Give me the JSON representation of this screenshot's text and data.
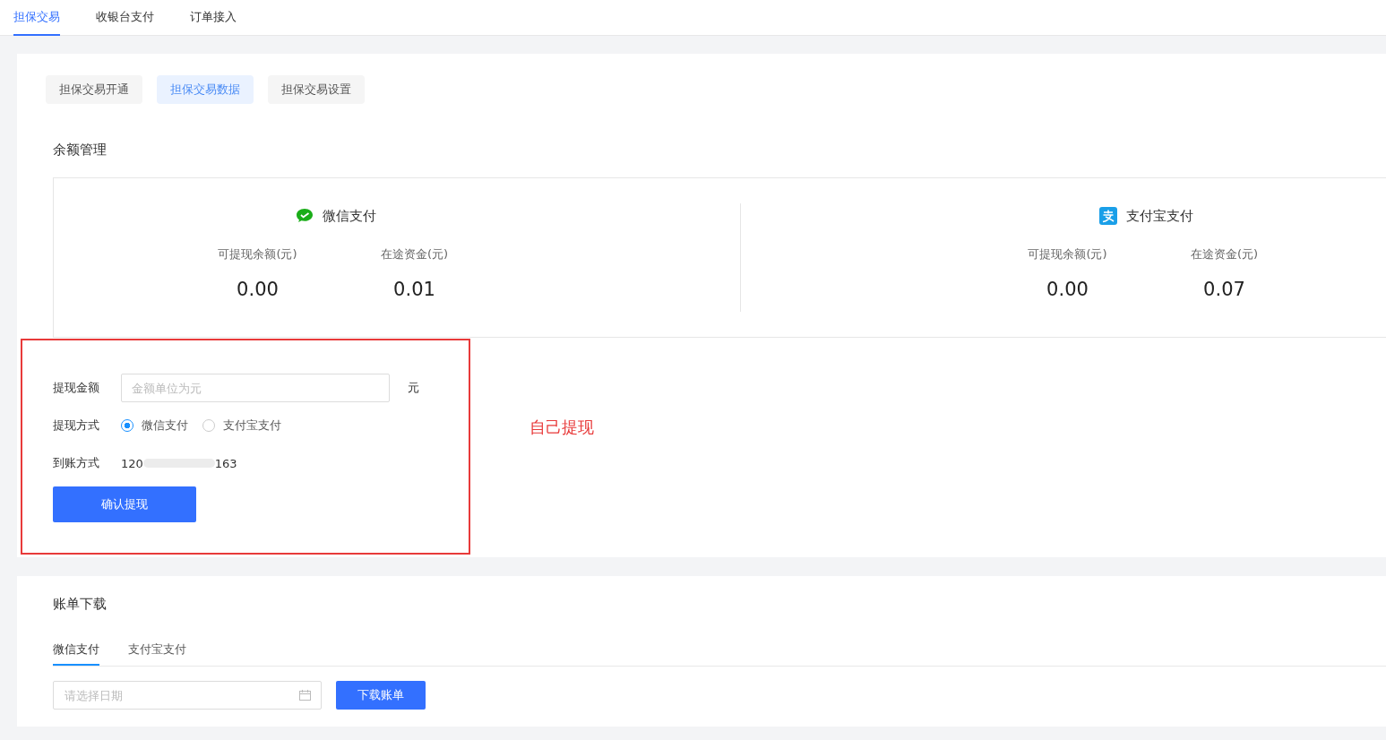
{
  "top_tabs": [
    {
      "label": "担保交易",
      "selected": true
    },
    {
      "label": "收银台支付",
      "selected": false
    },
    {
      "label": "订单接入",
      "selected": false
    }
  ],
  "sub_tabs": [
    {
      "label": "担保交易开通",
      "selected": false
    },
    {
      "label": "担保交易数据",
      "selected": true
    },
    {
      "label": "担保交易设置",
      "selected": false
    }
  ],
  "balance": {
    "title": "余额管理",
    "accounts": [
      {
        "kind": "wechat",
        "name": "微信支付",
        "stats": [
          {
            "label": "可提现余额(元)",
            "value": "0.00"
          },
          {
            "label": "在途资金(元)",
            "value": "0.01"
          }
        ]
      },
      {
        "kind": "alipay",
        "name": "支付宝支付",
        "stats": [
          {
            "label": "可提现余额(元)",
            "value": "0.00"
          },
          {
            "label": "在途资金(元)",
            "value": "0.07"
          }
        ]
      }
    ]
  },
  "withdraw": {
    "amount_label": "提现金额",
    "amount_placeholder": "金额单位为元",
    "unit": "元",
    "method_label": "提现方式",
    "methods": [
      {
        "label": "微信支付",
        "selected": true
      },
      {
        "label": "支付宝支付",
        "selected": false
      }
    ],
    "account_label": "到账方式",
    "account_prefix": "120",
    "account_suffix": "163",
    "submit": "确认提现"
  },
  "annotation": "自己提现",
  "bills": {
    "title": "账单下载",
    "tabs": [
      {
        "label": "微信支付",
        "selected": true
      },
      {
        "label": "支付宝支付",
        "selected": false
      }
    ],
    "date_placeholder": "请选择日期",
    "download": "下载账单"
  }
}
